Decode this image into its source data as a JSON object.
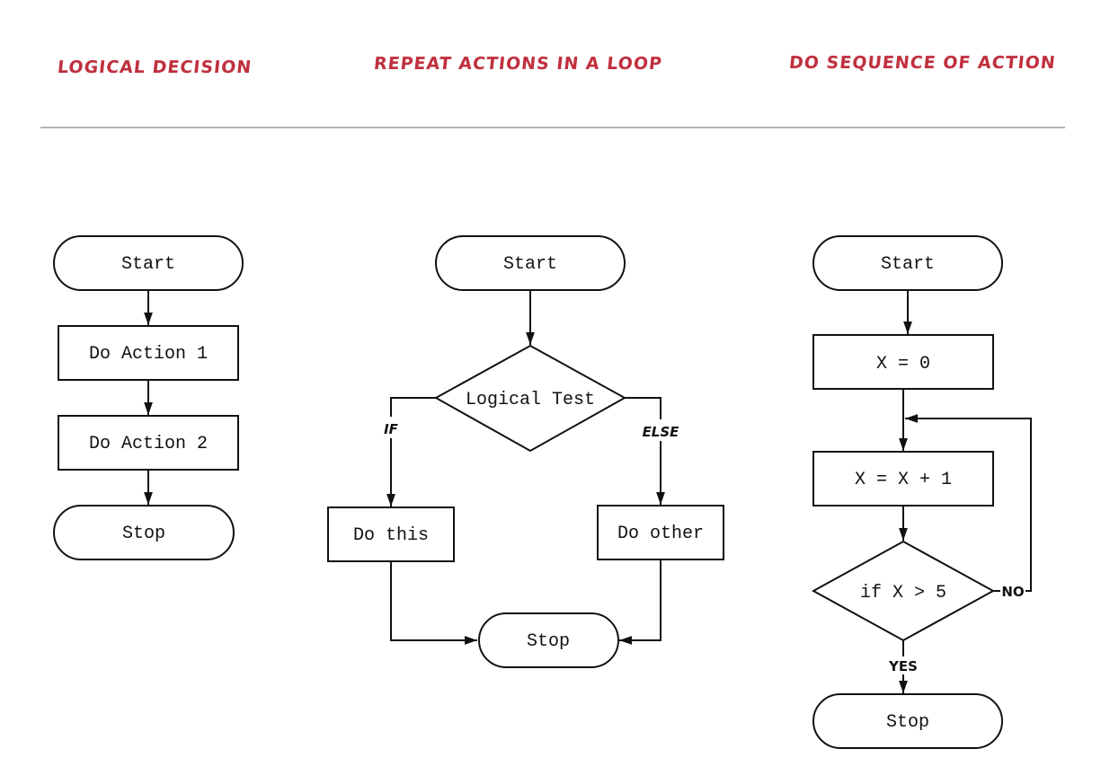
{
  "headings": {
    "col1": "LOGICAL DECISION",
    "col2": "REPEAT ACTIONS IN A LOOP",
    "col3": "DO SEQUENCE OF ACTION"
  },
  "colors": {
    "heading": "#c0303e",
    "divider": "#b3b3b3",
    "stroke": "#111111"
  },
  "flow_sequence": {
    "start": "Start",
    "action1": "Do Action 1",
    "action2": "Do Action 2",
    "stop": "Stop"
  },
  "flow_decision": {
    "start": "Start",
    "test": "Logical Test",
    "if_label": "IF",
    "else_label": "ELSE",
    "do_this": "Do this",
    "do_other": "Do other",
    "stop": "Stop"
  },
  "flow_loop": {
    "start": "Start",
    "init": "X = 0",
    "increment": "X = X + 1",
    "condition": "if X > 5",
    "no_label": "NO",
    "yes_label": "YES",
    "stop": "Stop"
  }
}
